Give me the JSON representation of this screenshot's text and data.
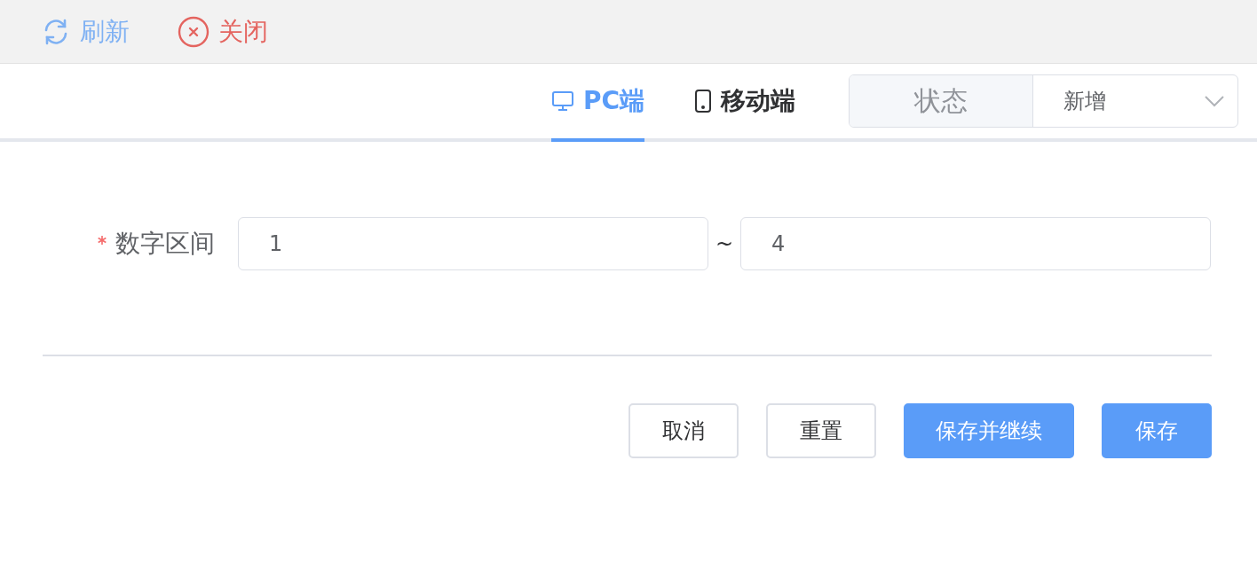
{
  "toolbar": {
    "actions": [
      {
        "kind": "refresh",
        "label": "刷新"
      },
      {
        "kind": "close",
        "label": "关闭"
      }
    ]
  },
  "tabs": [
    {
      "kind": "pc",
      "label": "PC端",
      "selected": true
    },
    {
      "kind": "mobile",
      "label": "移动端",
      "selected": false
    }
  ],
  "status": {
    "label": "状态",
    "value": "新增"
  },
  "form": {
    "fields": [
      {
        "label": "数字区间",
        "required": true,
        "from": "1",
        "separator": "~",
        "to": "4"
      }
    ]
  },
  "buttons": [
    {
      "kind": "default",
      "label": "取消"
    },
    {
      "kind": "default",
      "label": "重置"
    },
    {
      "kind": "primary",
      "label": "保存并继续"
    },
    {
      "kind": "primary",
      "label": "保存"
    }
  ]
}
